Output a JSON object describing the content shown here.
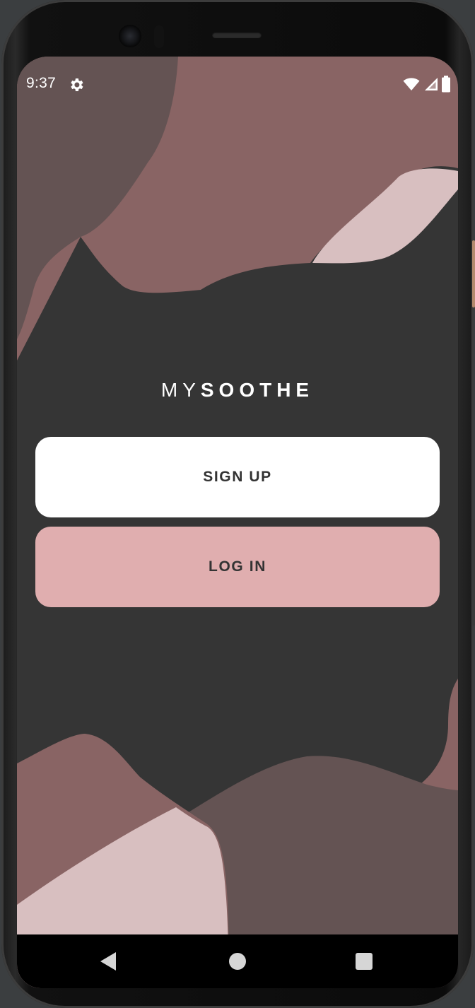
{
  "status_bar": {
    "time": "9:37",
    "left_icons": [
      "gear-icon"
    ],
    "right_icons": [
      "wifi-icon",
      "cell-signal-icon",
      "battery-icon"
    ]
  },
  "brand": {
    "prefix": "MY",
    "name": "SOOTHE"
  },
  "actions": {
    "sign_up_label": "SIGN UP",
    "log_in_label": "LOG IN"
  },
  "navigation": {
    "items": [
      "back-icon",
      "home-icon",
      "recents-icon"
    ]
  },
  "colors": {
    "background": "#353535",
    "sign_up_button": "#ffffff",
    "log_in_button": "#e0aeaf",
    "button_text": "#333333",
    "shape_rose": "#896464",
    "shape_mauve": "#645353",
    "shape_pink": "#d8bfc0"
  }
}
